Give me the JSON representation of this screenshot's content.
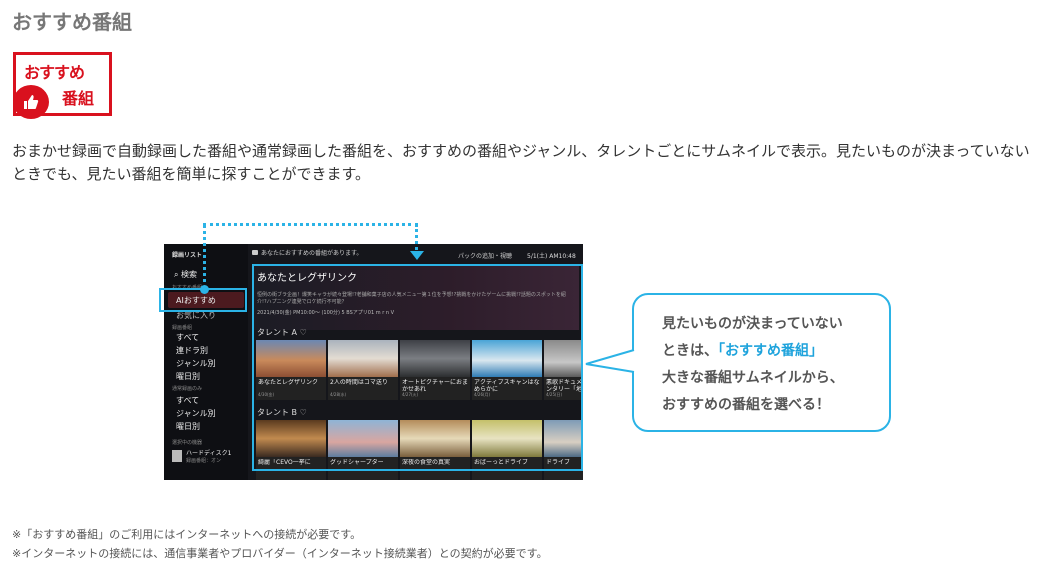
{
  "page": {
    "title": "おすすめ番組",
    "badge": {
      "line1": "おすすめ",
      "line2": "番組"
    },
    "description": "おまかせ録画で自動録画した番組や通常録画した番組を、おすすめの番組やジャンル、タレントごとにサムネイルで表示。見たいものが決まっていないときでも、見たい番組を簡単に探すことができます。"
  },
  "tv": {
    "sidebar": {
      "header": "録画リスト",
      "search": "検索",
      "section_osusume": "おすすめ番組",
      "selected": "AIおすすめ",
      "favorite": "お気に入り",
      "section_rec": "録画番組",
      "items_rec": [
        "すべて",
        "連ドラ別",
        "ジャンル別",
        "曜日別"
      ],
      "section_normal": "通常録画のみ",
      "items_normal": [
        "すべて",
        "ジャンル別",
        "曜日別"
      ],
      "section_device": "選択中の機器",
      "device_name": "ハードディスク1",
      "device_sub": "録画番組：オン"
    },
    "topbar": {
      "notice": "あなたにおすすめの番組があります。",
      "action": "パックの追加・視聴",
      "clock": "5/1(土) AM10:48"
    },
    "featured": {
      "title": "あなたとレグザリンク",
      "desc": "恒例の街ブラ企画！爆笑キャラが続々登場!?老舗和菓子店の人気メニュー第１位を予想!?挑戦をかけたゲームに挑戦!?話題のスポットを紹介!?ハプニング連発でロケ続行不可能？",
      "meta": "2021/4/30(金) PM10:00～ (100分) 5 BSアプリ01 m r n V"
    },
    "rows": [
      {
        "label": "タレント A",
        "cards": [
          {
            "caption": "あなたとレグザリンク",
            "date": "4/30(金)"
          },
          {
            "caption": "2人の時間はコマ送り",
            "date": "4/28(水)"
          },
          {
            "caption": "オートピクチャーにおまかせあれ",
            "date": "4/27(火)"
          },
          {
            "caption": "アクティブスキャンはなめらかに",
            "date": "4/26(月)"
          },
          {
            "caption": "悪歌ドキュメンタリー「地",
            "date": "4/25(日)"
          }
        ]
      },
      {
        "label": "タレント B",
        "cards": [
          {
            "caption": "綺麗「CEVO一挙に",
            "date": ""
          },
          {
            "caption": "グッドシャープター",
            "date": ""
          },
          {
            "caption": "深夜の食堂の真実",
            "date": ""
          },
          {
            "caption": "おばーっとドライブ",
            "date": ""
          },
          {
            "caption": "ドライブ",
            "date": ""
          }
        ]
      }
    ]
  },
  "callout": {
    "line1": "見たいものが決まっていない",
    "line2_pre": "ときは、",
    "line2_hl": "「おすすめ番組」",
    "line3": "大きな番組サムネイルから、",
    "line4": "おすすめの番組を選べる！"
  },
  "notes": [
    "※「おすすめ番組」のご利用にはインターネットへの接続が必要です。",
    "※インターネットの接続には、通信事業者やプロバイダー（インターネット接続業者）との契約が必要です。"
  ],
  "colors": {
    "accent": "#2bb3e6",
    "brand_red": "#d9111e",
    "highlight_text": "#1ea3dc"
  }
}
